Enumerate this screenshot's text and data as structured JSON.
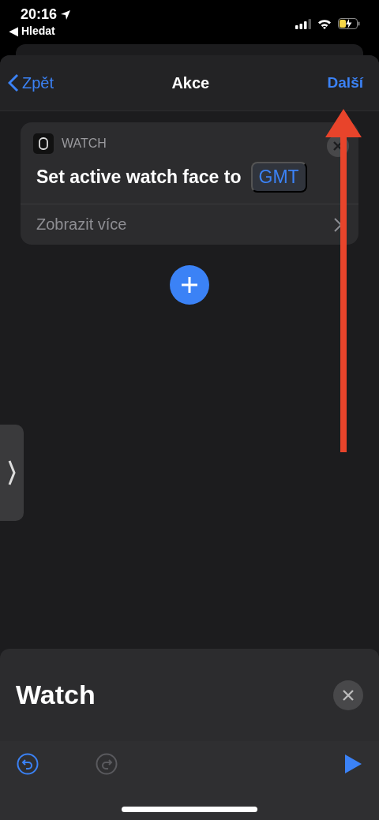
{
  "status_bar": {
    "time": "20:16",
    "back_label": "◀ Hledat"
  },
  "nav": {
    "back": "Zpět",
    "title": "Akce",
    "next": "Další"
  },
  "action_card": {
    "app": "WATCH",
    "text": "Set active watch face to",
    "parameter": "GMT",
    "more": "Zobrazit více"
  },
  "bottom_panel": {
    "title": "Watch"
  },
  "toolbar": [
    {
      "kind": "undo",
      "disabled": false
    },
    {
      "kind": "redo",
      "disabled": true
    },
    {
      "kind": "run",
      "disabled": false
    }
  ]
}
